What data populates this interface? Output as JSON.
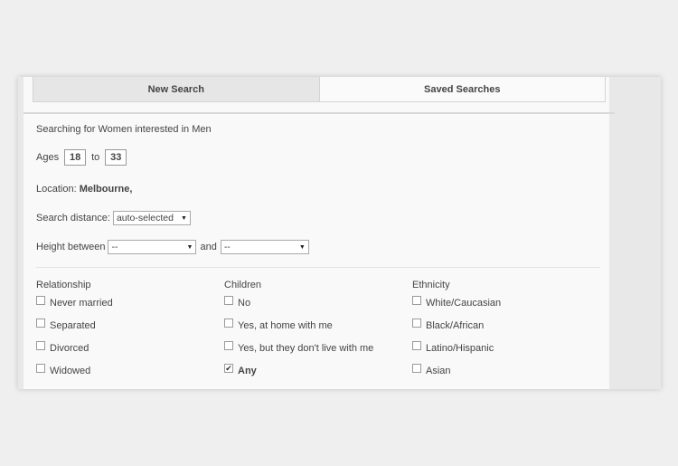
{
  "tabs": [
    {
      "label": "New Search",
      "active": true
    },
    {
      "label": "Saved Searches",
      "active": false
    }
  ],
  "search_summary": "Searching for Women interested in Men",
  "ages": {
    "label": "Ages",
    "min": "18",
    "to_label": "to",
    "max": "33"
  },
  "location": {
    "label": "Location:",
    "value": "Melbourne,"
  },
  "distance": {
    "label": "Search distance:",
    "selected": "auto-selected"
  },
  "height": {
    "label": "Height between",
    "from": "--",
    "and_label": "and",
    "to": "--"
  },
  "columns": [
    {
      "heading": "Relationship",
      "options": [
        {
          "label": "Never married",
          "checked": false
        },
        {
          "label": "Separated",
          "checked": false
        },
        {
          "label": "Divorced",
          "checked": false
        },
        {
          "label": "Widowed",
          "checked": false
        }
      ]
    },
    {
      "heading": "Children",
      "options": [
        {
          "label": "No",
          "checked": false
        },
        {
          "label": "Yes, at home with me",
          "checked": false
        },
        {
          "label": "Yes, but they don't live with me",
          "checked": false
        },
        {
          "label": "Any",
          "checked": true
        }
      ]
    },
    {
      "heading": "Ethnicity",
      "options": [
        {
          "label": "White/Caucasian",
          "checked": false
        },
        {
          "label": "Black/African",
          "checked": false
        },
        {
          "label": "Latino/Hispanic",
          "checked": false
        },
        {
          "label": "Asian",
          "checked": false
        }
      ]
    }
  ]
}
